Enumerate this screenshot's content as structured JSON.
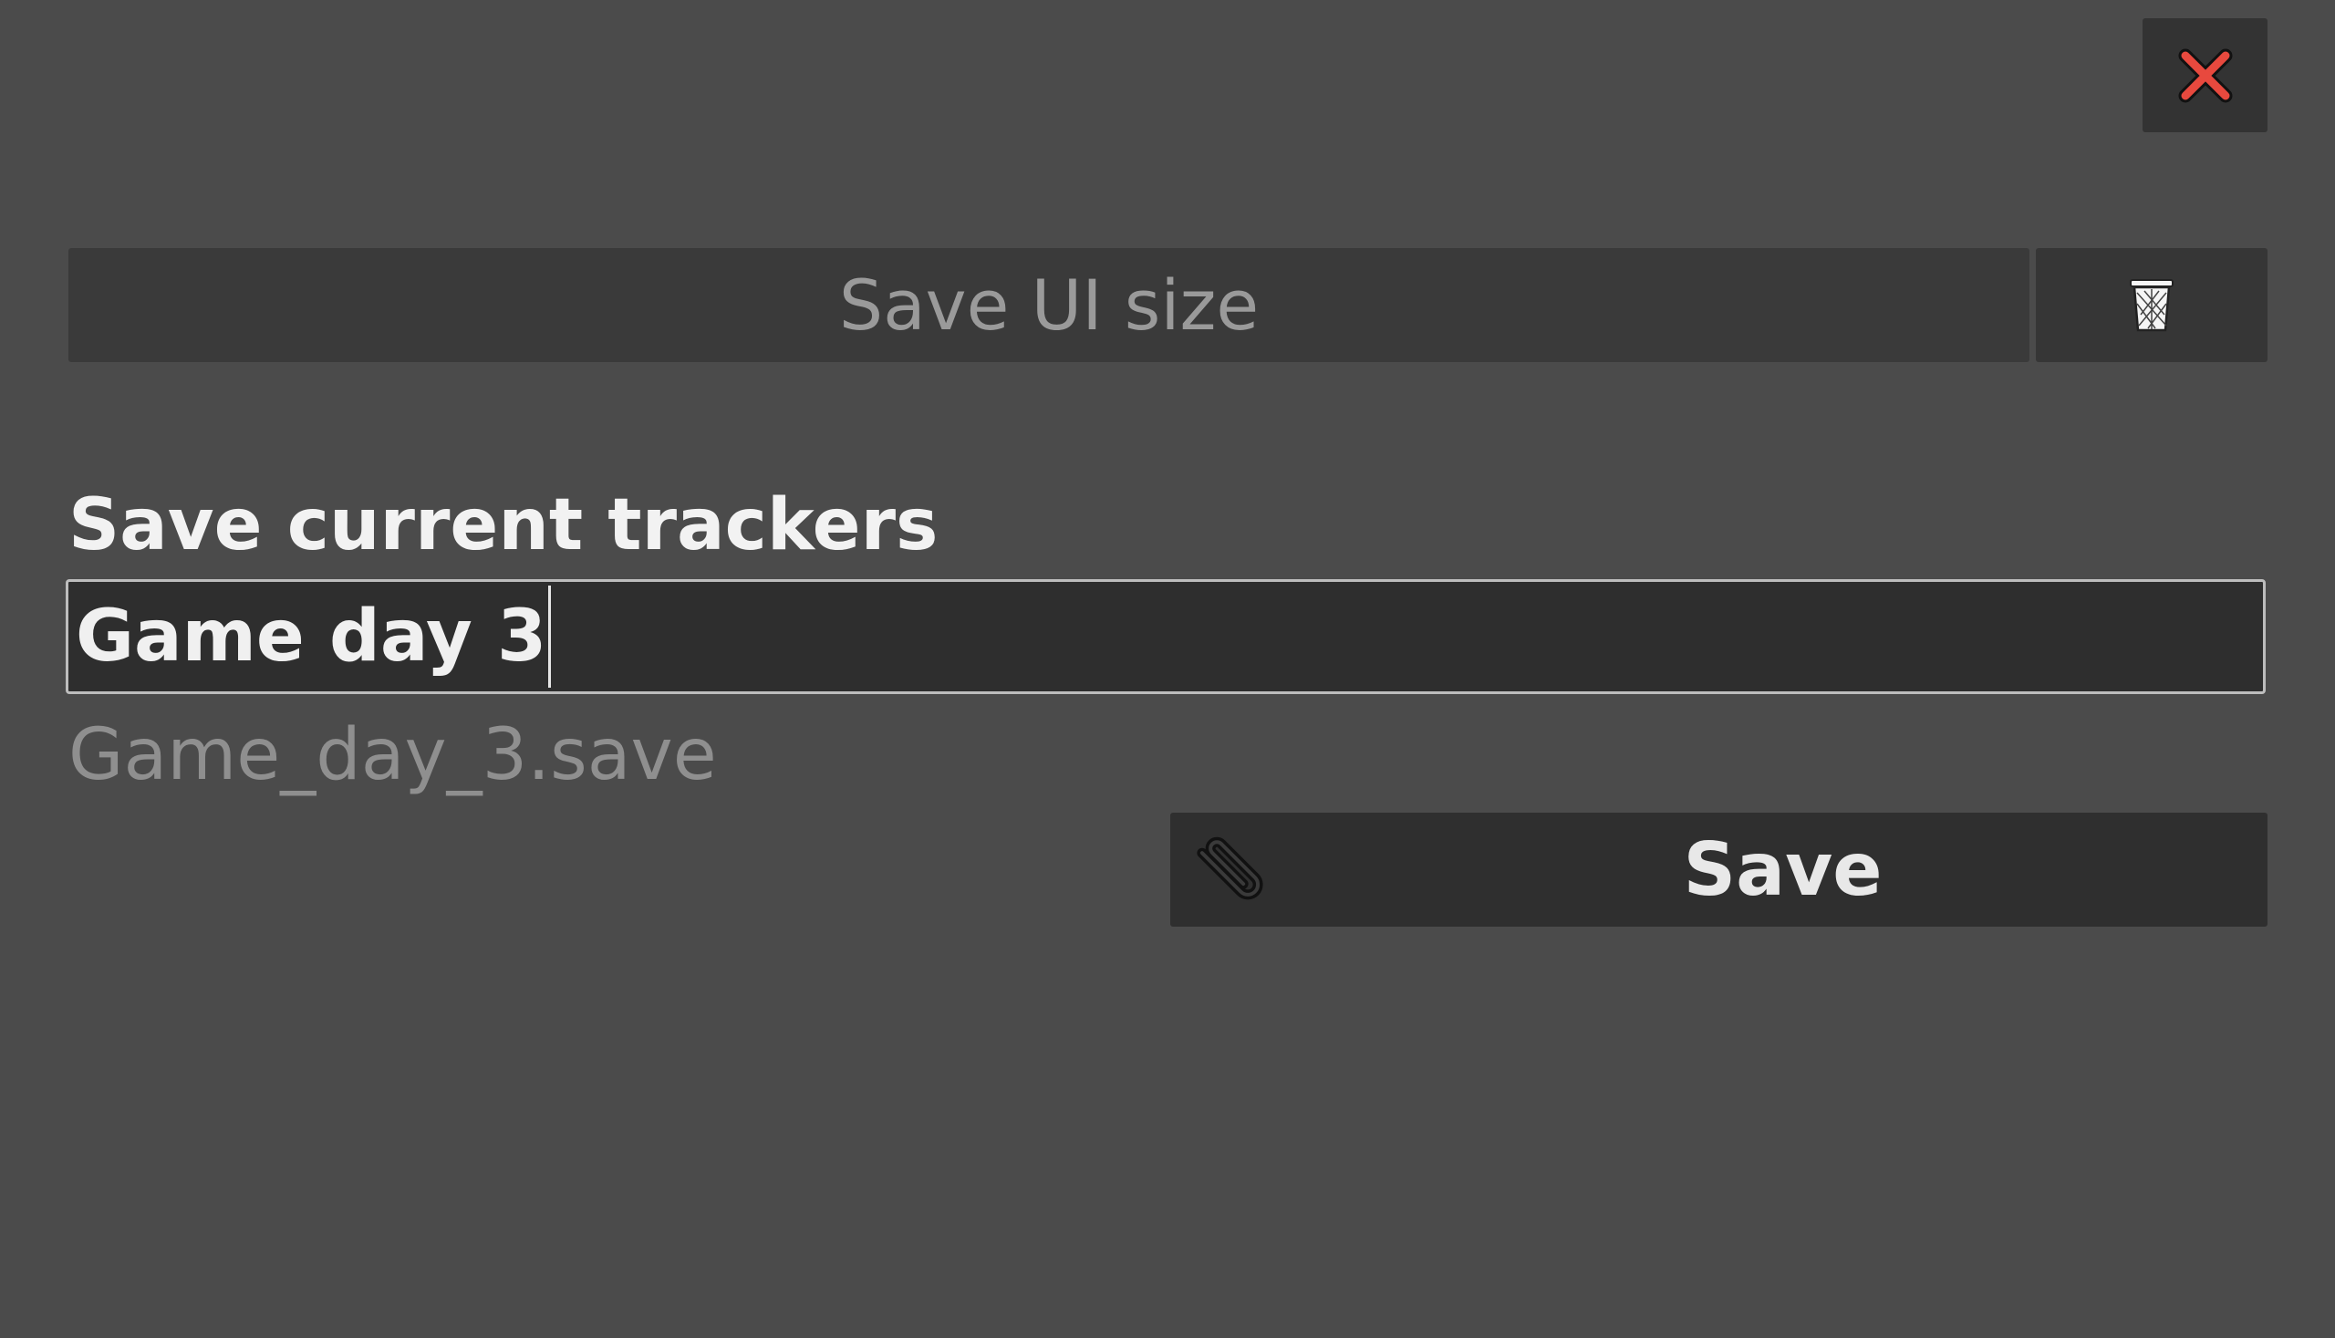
{
  "window": {
    "close_icon": "close-icon",
    "close_color": "#e8493e"
  },
  "ui_size": {
    "button_label": "Save UI size",
    "delete_icon": "trash-icon"
  },
  "trackers": {
    "section_title": "Save current trackers",
    "name_value": "Game day 3",
    "filename_preview": "Game_day_3.save",
    "save_label": "Save",
    "save_icon": "paperclip-icon"
  }
}
